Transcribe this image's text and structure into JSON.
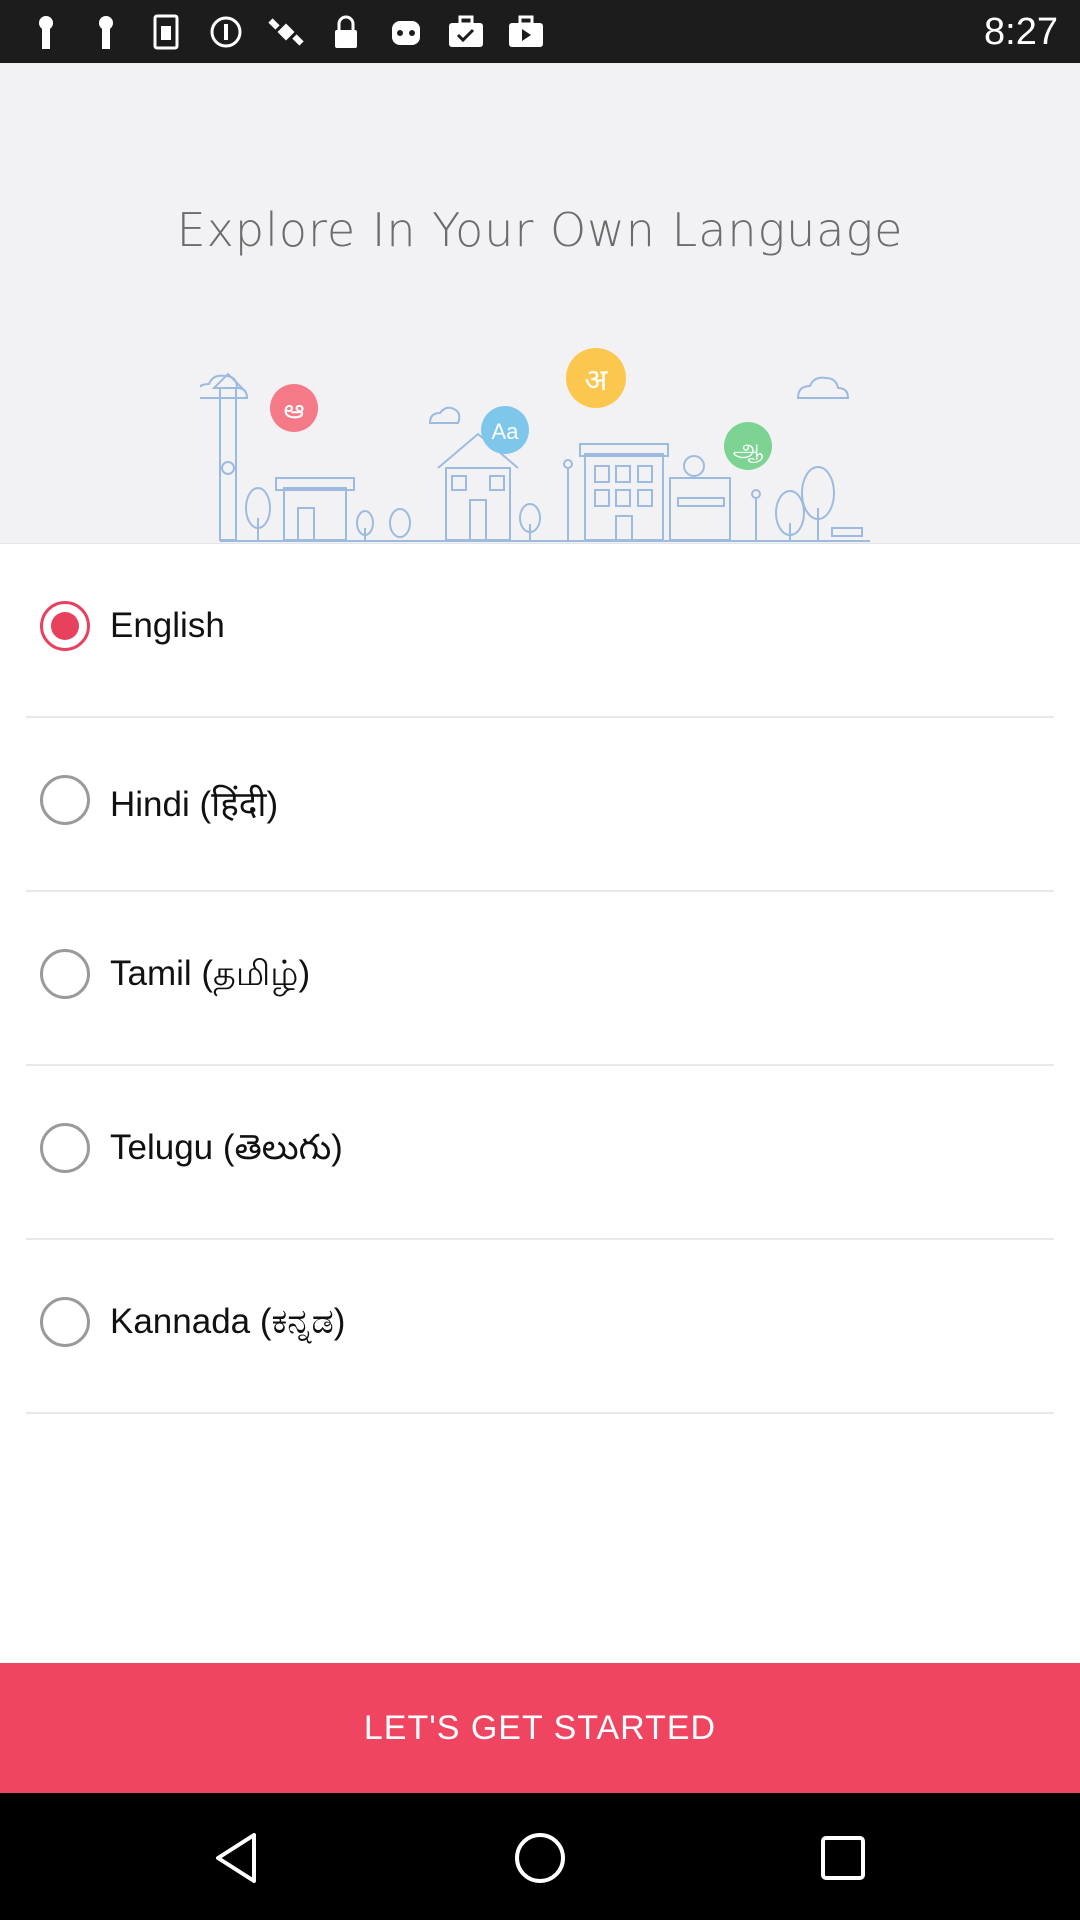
{
  "status_bar": {
    "time": "8:27",
    "icons": [
      "notification-icon",
      "notification-icon",
      "sim-card-icon",
      "info-icon",
      "satellite-icon",
      "lock-icon",
      "robot-icon",
      "briefcase-check-icon",
      "briefcase-icon"
    ]
  },
  "header": {
    "title": "Explore In Your Own Language",
    "illustration_bubbles": [
      "ఆ",
      "Aa",
      "अ",
      "ஆ"
    ]
  },
  "languages": [
    {
      "label": "English",
      "selected": true
    },
    {
      "label": "Hindi (हिंदी)",
      "selected": false
    },
    {
      "label": "Tamil (தமிழ்)",
      "selected": false
    },
    {
      "label": "Telugu (తెలుగు)",
      "selected": false
    },
    {
      "label": "Kannada (ಕನ್ನಡ)",
      "selected": false
    }
  ],
  "cta": {
    "label": "LET'S GET STARTED"
  },
  "nav": {
    "back": "back-icon",
    "home": "home-icon",
    "recents": "recents-icon"
  },
  "colors": {
    "accent": "#f04561",
    "header_bg": "#f2f2f4",
    "illustration_blue": "#8fb3d9"
  }
}
